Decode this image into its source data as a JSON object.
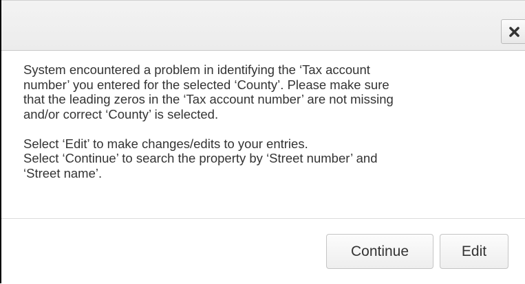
{
  "header": {
    "close_icon": "close-icon"
  },
  "message": {
    "paragraph1_lines": [
      "System encountered a problem in identifying the ‘Tax account",
      "number’ you entered for the selected ‘County’. Please make sure",
      "that the leading zeros in the ‘Tax account number’ are not missing",
      "and/or correct ‘County’ is selected."
    ],
    "paragraph2_lines": [
      "Select ‘Edit’ to make changes/edits to your entries.",
      "Select ‘Continue’ to search the property by ‘Street number’ and",
      "‘Street name’."
    ]
  },
  "footer": {
    "continue_label": "Continue",
    "edit_label": "Edit"
  },
  "colors": {
    "text": "#333333",
    "header_bg": "#f0f0f0",
    "button_border": "#c4c4c4"
  }
}
